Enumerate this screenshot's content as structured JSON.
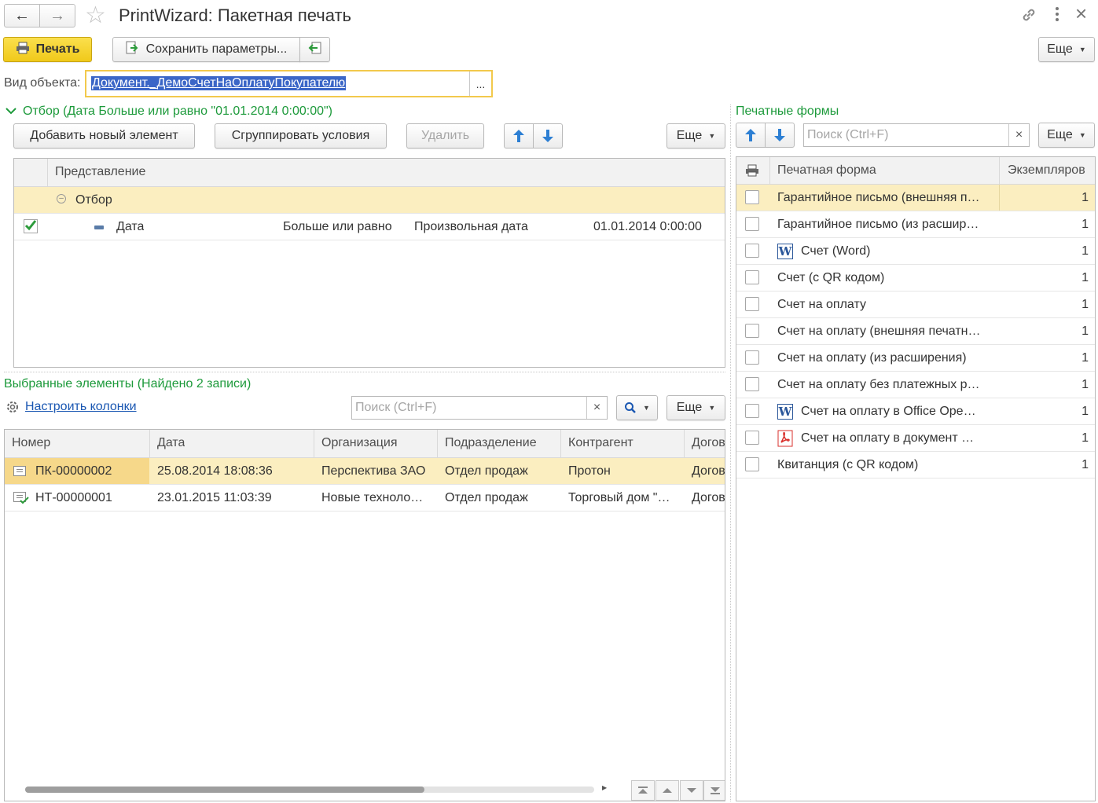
{
  "window": {
    "title": "PrintWizard: Пакетная печать"
  },
  "toolbar": {
    "print_label": "Печать",
    "save_params_label": "Сохранить параметры...",
    "more_label": "Еще"
  },
  "object_type": {
    "label": "Вид объекта:",
    "value": "Документ._ДемоСчетНаОплатуПокупателю",
    "choose_label": "..."
  },
  "filter": {
    "section_title": "Отбор (Дата Больше или равно \"01.01.2014 0:00:00\")",
    "add_label": "Добавить новый элемент",
    "group_label": "Сгруппировать условия",
    "delete_label": "Удалить",
    "more_label": "Еще",
    "column_header": "Представление",
    "group_row": "Отбор",
    "condition": {
      "field": "Дата",
      "comparison": "Больше или равно",
      "value_type": "Произвольная дата",
      "value": "01.01.2014 0:00:00",
      "enabled": true
    }
  },
  "selected": {
    "section_title": "Выбранные элементы (Найдено 2 записи)",
    "configure_columns_label": "Настроить колонки",
    "search_placeholder": "Поиск (Ctrl+F)",
    "clear_label": "×",
    "more_label": "Еще",
    "columns": [
      "Номер",
      "Дата",
      "Организация",
      "Подразделение",
      "Контрагент",
      "Догов"
    ],
    "rows": [
      {
        "number": "ПК-00000002",
        "date": "25.08.2014 18:08:36",
        "organization": "Перспектива ЗАО",
        "department": "Отдел продаж",
        "counterparty": "Протон",
        "contract": "Догов",
        "selected": true
      },
      {
        "number": "НТ-00000001",
        "date": "23.01.2015 11:03:39",
        "organization": "Новые техноло…",
        "department": "Отдел продаж",
        "counterparty": "Торговый дом \"…",
        "contract": "Догов",
        "selected": false
      }
    ]
  },
  "print_forms": {
    "section_title": "Печатные формы",
    "search_placeholder": "Поиск (Ctrl+F)",
    "clear_label": "×",
    "more_label": "Еще",
    "col_form": "Печатная форма",
    "col_copies": "Экземпляров",
    "items": [
      {
        "name": "Гарантийное письмо (внешняя п…",
        "copies": "1",
        "icon": "",
        "selected": true
      },
      {
        "name": "Гарантийное письмо (из расшир…",
        "copies": "1",
        "icon": ""
      },
      {
        "name": "Счет (Word)",
        "copies": "1",
        "icon": "word-icon"
      },
      {
        "name": "Счет (с QR кодом)",
        "copies": "1",
        "icon": ""
      },
      {
        "name": "Счет на оплату",
        "copies": "1",
        "icon": ""
      },
      {
        "name": "Счет на оплату (внешняя печатн…",
        "copies": "1",
        "icon": ""
      },
      {
        "name": "Счет на оплату (из расширения)",
        "copies": "1",
        "icon": ""
      },
      {
        "name": "Счет на оплату без платежных р…",
        "copies": "1",
        "icon": ""
      },
      {
        "name": "Счет на оплату в Office Ope…",
        "copies": "1",
        "icon": "word-icon"
      },
      {
        "name": "Счет на оплату в документ …",
        "copies": "1",
        "icon": "pdf-icon"
      },
      {
        "name": "Квитанция (с QR кодом)",
        "copies": "1",
        "icon": ""
      }
    ]
  },
  "colors": {
    "accent_green": "#1d9a3b",
    "print_button": "#f5d327",
    "selected_row": "#fbeec0",
    "arrow_blue": "#2d7fd3"
  }
}
